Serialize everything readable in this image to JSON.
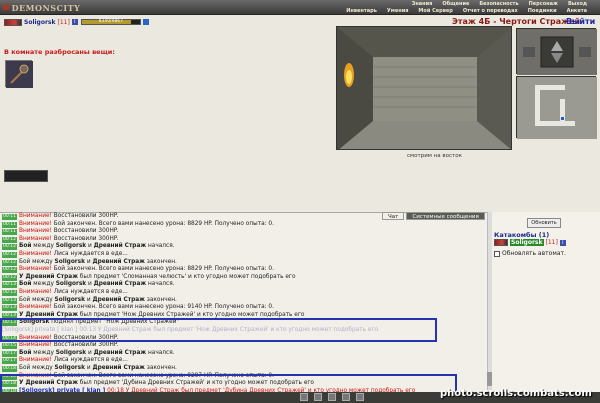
{
  "app": {
    "logo": "DEMONSCITY",
    "menu_top": [
      "Знания",
      "Общение",
      "Безопасность",
      "Персонаж",
      "Выход"
    ],
    "menu_bottom": [
      "Инвентарь",
      "Умения",
      "Мой Сервер",
      "Отчет о переводах",
      "Поединки",
      "Анкета"
    ]
  },
  "user": {
    "nick": "Soligorsk",
    "level": "[11]",
    "hp_text": "8340/9867",
    "hp_fraction": 0.85
  },
  "location": {
    "title": "Этаж 4Б - Чертоги Стражей",
    "exit_label": "Выйти",
    "caption": "смотрим на восток"
  },
  "items": {
    "title": "В комнате разбросаны вещи:"
  },
  "chat": {
    "tab_chat": "Чат",
    "tab_system": "Системные сообщения",
    "lines": [
      {
        "ts": "00:11",
        "warn": "Внимание!",
        "text": " Восстановили 300HP."
      },
      {
        "ts": "00:11",
        "warn": "Внимание!",
        "text": " Бой закончен. Всего вами нанесено урона: 8829 HP. Получено опыта: 0."
      },
      {
        "ts": "00:11",
        "warn": "Внимание!",
        "text": " Восстановили 300HP."
      },
      {
        "ts": "00:12",
        "warn": "Внимание!",
        "text": " Восстановили 300HP."
      },
      {
        "ts": "00:12",
        "bold_a": "Бой",
        "mid": " между ",
        "bold_b": "Soligorsk",
        "mid2": " и ",
        "bold_c": "Древний Страж",
        "tail": " начался."
      },
      {
        "ts": "00:12",
        "warn": "Внимание!",
        "text": " Лиса нуждается в еде..."
      },
      {
        "ts": "00:12",
        "plain_a": "Бой между ",
        "bold_b": "Soligorsk",
        "mid2": " и ",
        "bold_c": "Древний Страж",
        "tail": " закончен."
      },
      {
        "ts": "00:12",
        "warn": "Внимание!",
        "text": " Бой закончен. Всего вами нанесено урона: 8829 HP. Получено опыта: 0."
      },
      {
        "ts": "00:12",
        "bold_a": "У Древний Страж",
        "tail": " был предмет 'Сломанная челюсть' и кто угодно может подобрать его"
      },
      {
        "ts": "00:13",
        "bold_a": "Бой",
        "mid": " между ",
        "bold_b": "Soligorsk",
        "mid2": " и ",
        "bold_c": "Древний Страж",
        "tail": " начался."
      },
      {
        "ts": "00:13",
        "warn": "Внимание!",
        "text": " Лиса нуждается в еде..."
      },
      {
        "ts": "00:13",
        "plain_a": "Бой между ",
        "bold_b": "Soligorsk",
        "mid2": " и ",
        "bold_c": "Древний Страж",
        "tail": " закончен."
      },
      {
        "ts": "00:13",
        "warn": "Внимание!",
        "text": " Бой закончен. Всего вами нанесено урона: 9140 HP. Получено опыта: 0."
      },
      {
        "ts": "00:13",
        "bold_a": "У Древний Страж",
        "tail": " был предмет 'Нож Древних Стражей' и кто угодно может подобрать его"
      },
      {
        "ts": "00:13",
        "bold_a": "Soligorsk",
        "tail": " поднял предмет \"Нож Древних Стражей\""
      },
      {
        "ts": "",
        "faded": "[Soligorsk] private [ klan ] 00:13 У Древний Страж был предмет 'Нож Древних Стражей' и кто угодно может подобрать его"
      },
      {
        "ts": "00:14",
        "warn": "Внимание!",
        "text": " Восстановили 300HP."
      },
      {
        "ts": "00:15",
        "warn": "Внимание!",
        "text": " Восстановили 300HP."
      },
      {
        "ts": "00:17",
        "bold_a": "Бой",
        "mid": " между ",
        "bold_b": "Soligorsk",
        "mid2": " и ",
        "bold_c": "Древний Страж",
        "tail": " начался."
      },
      {
        "ts": "00:17",
        "warn": "Внимание!",
        "text": " Лиса нуждается в еде..."
      },
      {
        "ts": "00:18",
        "plain_a": "Бой между ",
        "bold_b": "Soligorsk",
        "mid2": " и ",
        "bold_c": "Древний Страж",
        "tail": " закончен."
      },
      {
        "ts": "00:18",
        "warn": "Внимание!",
        "text": " Бой закончен. Всего вами нанесено урона: 9297 HP. Получено опыта: 0."
      },
      {
        "ts": "00:18",
        "bold_a": "У Древний Страж",
        "tail": " был предмет 'Дубина Древних Стражей' и кто угодно может подобрать его"
      },
      {
        "ts": "00:18",
        "blue": "[Soligorsk] private [ klan ]",
        "red": " 00:18 У Древний Страж был предмет 'Дубина Древних Стражей' и кто угодно может подобрать его"
      }
    ]
  },
  "right_panel": {
    "refresh_label": "Обновить",
    "catacomb_title": "Катакомбы (1)",
    "member_nick": "Soligorsk",
    "member_level": "[11]",
    "auto_update_label": "Обновлять автомат."
  },
  "footer": {
    "watermark": "photo.scrolls.combats.com"
  }
}
